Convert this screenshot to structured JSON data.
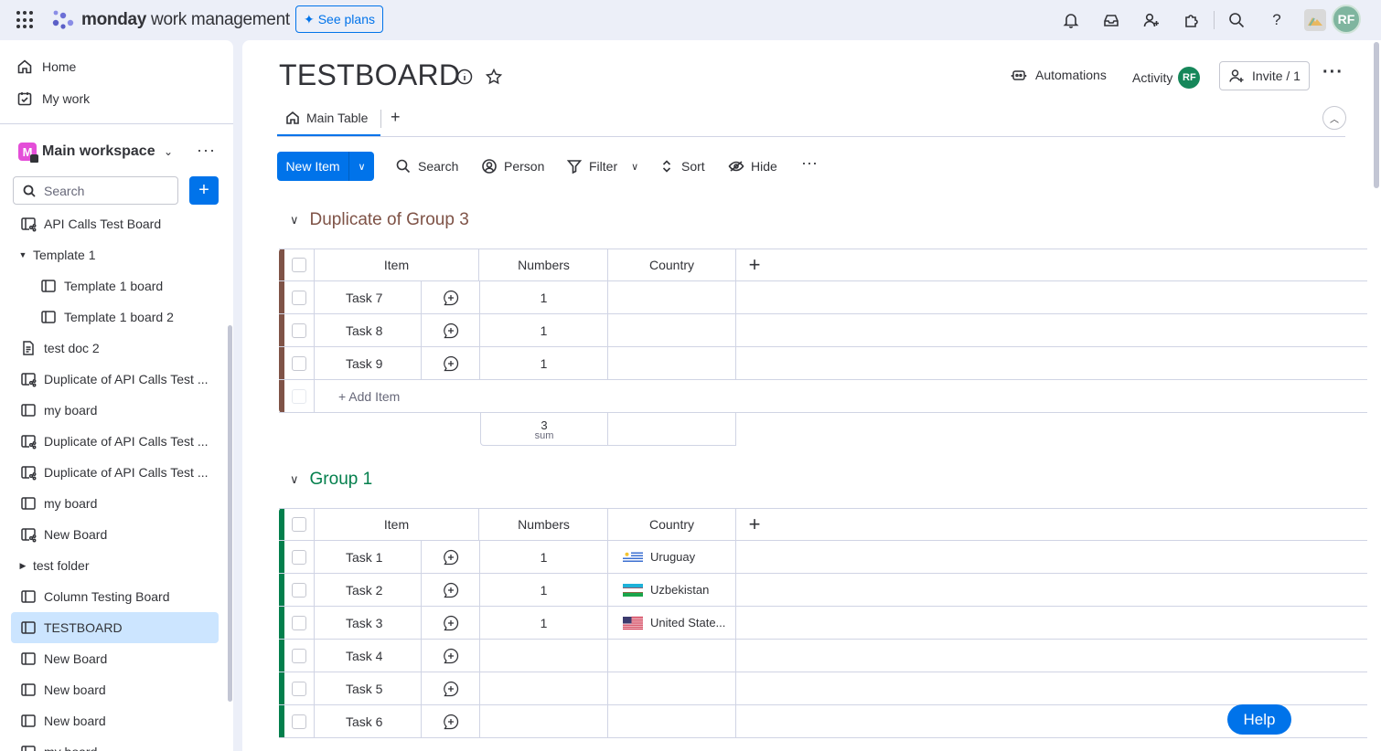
{
  "topbar": {
    "brand_bold": "monday",
    "brand_rest": " work management",
    "see_plans": "See plans",
    "avatar_initials": "RF"
  },
  "sidebar": {
    "home": "Home",
    "my_work": "My work",
    "workspace_badge": "M",
    "workspace_name": "Main workspace",
    "search_placeholder": "Search",
    "add_label": "+",
    "items": [
      {
        "label": "API Calls Test Board",
        "icon": "board-share-icon",
        "indent": 0,
        "caret": ""
      },
      {
        "label": "Template 1",
        "icon": "",
        "indent": 0,
        "caret": "open"
      },
      {
        "label": "Template 1 board",
        "icon": "board-icon",
        "indent": 1,
        "caret": ""
      },
      {
        "label": "Template 1 board 2",
        "icon": "board-icon",
        "indent": 1,
        "caret": ""
      },
      {
        "label": "test doc 2",
        "icon": "doc-icon",
        "indent": 0,
        "caret": ""
      },
      {
        "label": "Duplicate of API Calls Test ...",
        "icon": "board-share-icon",
        "indent": 0,
        "caret": ""
      },
      {
        "label": "my board",
        "icon": "board-icon",
        "indent": 0,
        "caret": ""
      },
      {
        "label": "Duplicate of API Calls Test ...",
        "icon": "board-share-icon",
        "indent": 0,
        "caret": ""
      },
      {
        "label": "Duplicate of API Calls Test ...",
        "icon": "board-share-icon",
        "indent": 0,
        "caret": ""
      },
      {
        "label": "my board",
        "icon": "board-icon",
        "indent": 0,
        "caret": ""
      },
      {
        "label": "New Board",
        "icon": "board-share-icon",
        "indent": 0,
        "caret": ""
      },
      {
        "label": "test folder",
        "icon": "",
        "indent": 0,
        "caret": "closed"
      },
      {
        "label": "Column Testing Board",
        "icon": "board-icon",
        "indent": 0,
        "caret": ""
      },
      {
        "label": "TESTBOARD",
        "icon": "board-icon",
        "indent": 0,
        "caret": "",
        "selected": true
      },
      {
        "label": "New Board",
        "icon": "board-icon",
        "indent": 0,
        "caret": ""
      },
      {
        "label": "New board",
        "icon": "board-icon",
        "indent": 0,
        "caret": ""
      },
      {
        "label": "New board",
        "icon": "board-icon",
        "indent": 0,
        "caret": ""
      },
      {
        "label": "my board",
        "icon": "board-icon",
        "indent": 0,
        "caret": ""
      }
    ]
  },
  "board": {
    "title": "TESTBOARD",
    "automations": "Automations",
    "activity": "Activity",
    "activity_avatar": "RF",
    "invite": "Invite / 1",
    "tab_main": "Main Table",
    "tab_add": "+"
  },
  "toolbar": {
    "new_item": "New Item",
    "search": "Search",
    "person": "Person",
    "filter": "Filter",
    "sort": "Sort",
    "hide": "Hide"
  },
  "columns": {
    "item": "Item",
    "numbers": "Numbers",
    "country": "Country"
  },
  "groups": [
    {
      "title": "Duplicate of Group 3",
      "color": "#7f5347",
      "rows": [
        {
          "item": "Task 7",
          "numbers": "1",
          "country": "",
          "flag": ""
        },
        {
          "item": "Task 8",
          "numbers": "1",
          "country": "",
          "flag": ""
        },
        {
          "item": "Task 9",
          "numbers": "1",
          "country": "",
          "flag": ""
        }
      ],
      "add_item": "+ Add Item",
      "sum_value": "3",
      "sum_label": "sum"
    },
    {
      "title": "Group 1",
      "color": "#037f4c",
      "rows": [
        {
          "item": "Task 1",
          "numbers": "1",
          "country": "Uruguay",
          "flag": "uy"
        },
        {
          "item": "Task 2",
          "numbers": "1",
          "country": "Uzbekistan",
          "flag": "uz"
        },
        {
          "item": "Task 3",
          "numbers": "1",
          "country": "United State...",
          "flag": "us"
        },
        {
          "item": "Task 4",
          "numbers": "",
          "country": "",
          "flag": ""
        },
        {
          "item": "Task 5",
          "numbers": "",
          "country": "",
          "flag": ""
        },
        {
          "item": "Task 6",
          "numbers": "",
          "country": "",
          "flag": ""
        }
      ]
    }
  ],
  "help": "Help"
}
